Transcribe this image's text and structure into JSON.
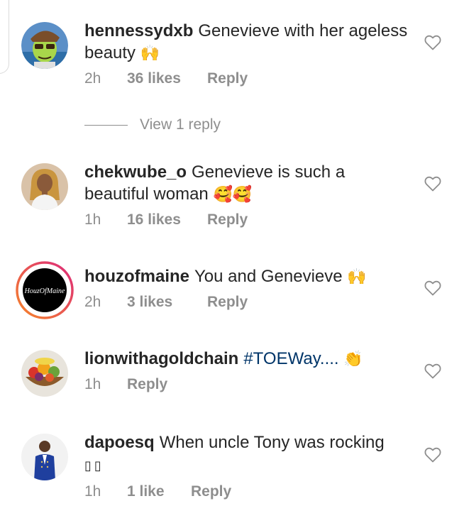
{
  "comments": [
    {
      "username": "hennessydxb",
      "text": "Genevieve with her ageless beauty",
      "emoji": "🙌",
      "time": "2h",
      "likes": "36 likes",
      "reply": "Reply",
      "avatar_icon": "cartoon-avatar-icon",
      "heart_icon": "heart-outline-icon"
    },
    {
      "username": "chekwube_o",
      "text": "Genevieve is such a beautiful woman",
      "emoji": "🥰🥰",
      "time": "1h",
      "likes": "16 likes",
      "reply": "Reply",
      "avatar_icon": "profile-photo-icon",
      "heart_icon": "heart-outline-icon"
    },
    {
      "username": "houzofmaine",
      "text": "You and Genevieve",
      "emoji": "🙌",
      "time": "2h",
      "likes": "3 likes",
      "reply": "Reply",
      "avatar_logo_text": "HouzOfMaine",
      "avatar_icon": "brand-logo-icon",
      "heart_icon": "heart-outline-icon"
    },
    {
      "username": "lionwithagoldchain",
      "text": "#TOEWay....",
      "emoji": "👏",
      "time": "1h",
      "reply": "Reply",
      "avatar_icon": "fruit-basket-icon",
      "heart_icon": "heart-outline-icon"
    },
    {
      "username": "dapoesq",
      "text": "When uncle Tony was rocking",
      "trailing_glyphs": "▯▯",
      "time": "1h",
      "likes": "1 like",
      "reply": "Reply",
      "avatar_icon": "profile-photo-icon",
      "heart_icon": "heart-outline-icon"
    }
  ],
  "view_replies": {
    "label": "View 1 reply"
  },
  "colors": {
    "text": "#262626",
    "meta": "#8e8e8e",
    "hashtag": "#003569",
    "story_ring_start": "#f58529",
    "story_ring_end": "#dd2a7b"
  }
}
